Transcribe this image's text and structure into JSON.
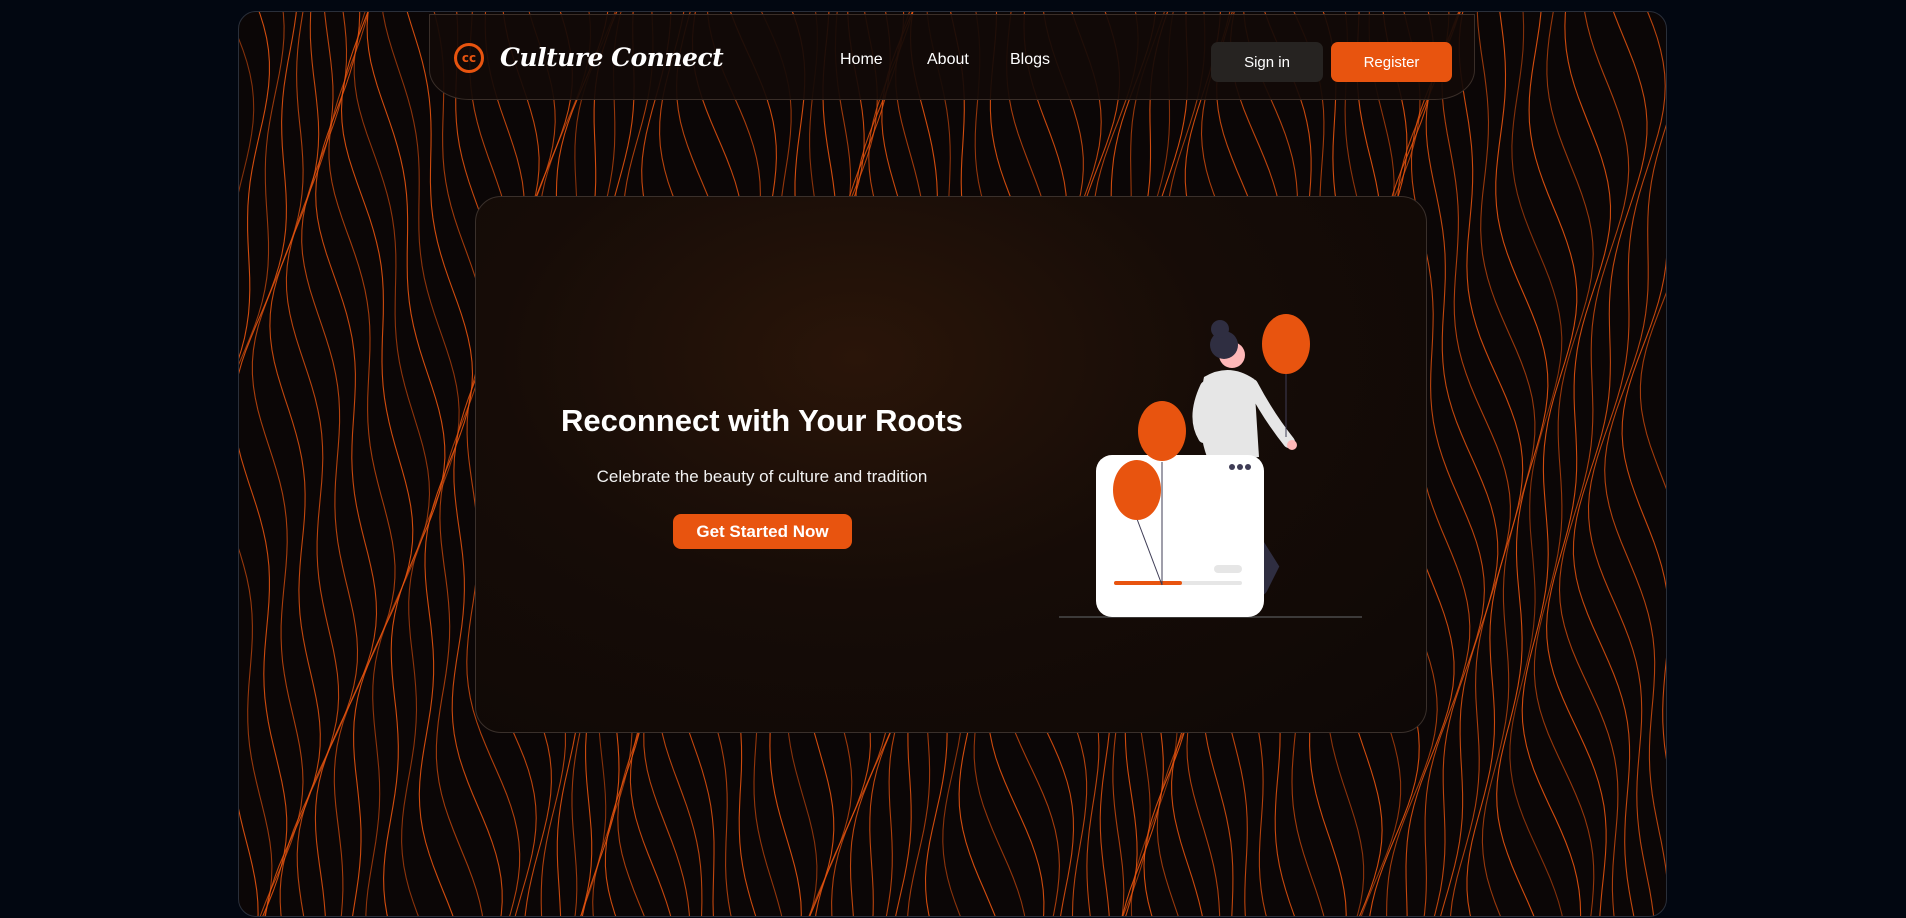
{
  "brand": {
    "logo_text": "cc",
    "name": "Culture Connect",
    "accent_color": "#e8540f"
  },
  "nav": {
    "links": [
      "Home",
      "About",
      "Blogs"
    ],
    "signin_label": "Sign in",
    "register_label": "Register"
  },
  "hero": {
    "title": "Reconnect with Your Roots",
    "subtitle": "Celebrate the beauty of culture and tradition",
    "cta_label": "Get Started Now",
    "illustration": "woman-with-balloons-illustration"
  },
  "background": {
    "pattern": "wavy-orange-contour-lines",
    "line_color": "#e8540f",
    "base_color": "#0b0606"
  }
}
